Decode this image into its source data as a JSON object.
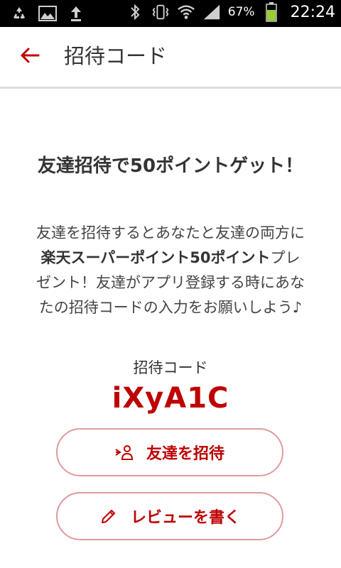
{
  "status_bar": {
    "battery_percent": "67%",
    "time": "22:24",
    "icons": [
      "recycle-icon",
      "image-icon",
      "upload-icon",
      "bluetooth-icon",
      "vibrate-icon",
      "wifi-icon",
      "signal-icon",
      "battery-icon"
    ],
    "battery_color": "#9acd32"
  },
  "appbar": {
    "title": "招待コード",
    "back_icon": "arrow-left-icon"
  },
  "content": {
    "headline": "友達招待で50ポイントゲット！",
    "description_part1": "友達を招待するとあなたと友達の両方に",
    "description_bold": "楽天スーパーポイント50ポイント",
    "description_part2": "プレゼント！友達がアプリ登録する時にあなたの招待コードの入力をお願いしよう♪",
    "code_label": "招待コード",
    "code_value": "iXyA1C"
  },
  "buttons": {
    "invite_label": "友達を招待",
    "invite_icon": "add-person-icon",
    "review_label": "レビューを書く",
    "review_icon": "pencil-icon"
  },
  "colors": {
    "accent": "#bf0000",
    "button_border": "#e09a9e"
  }
}
